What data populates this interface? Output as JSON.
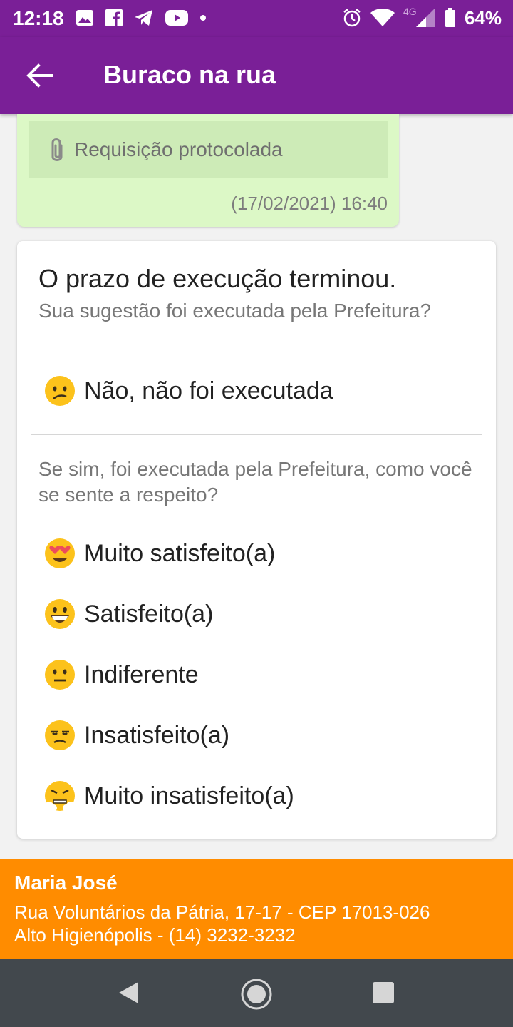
{
  "status_bar": {
    "time": "12:18",
    "battery_text": "64%",
    "network_label": "4G",
    "left_icons": [
      "image-icon",
      "facebook-icon",
      "telegram-icon",
      "youtube-icon",
      "dot-icon"
    ],
    "right_icons": [
      "alarm-icon",
      "wifi-icon",
      "signal-icon",
      "battery-icon"
    ]
  },
  "app_bar": {
    "title": "Buraco na rua",
    "back_icon": "arrow-back-icon",
    "color": "#7a1f97"
  },
  "message": {
    "attachment_label": "Requisição protocolada",
    "attachment_icon": "paperclip-icon",
    "timestamp": "(17/02/2021) 16:40",
    "bubble_color": "#dcf8c6"
  },
  "survey": {
    "title": "O prazo de execução terminou.",
    "question": "Sua sugestão foi executada pela Prefeitura?",
    "not_executed_option": {
      "emoji": "confused-face-icon",
      "label": "Não, não foi executada"
    },
    "satisfaction_question": "Se sim, foi executada pela Prefeitura, como você se sente a respeito?",
    "options": [
      {
        "emoji": "heart-eyes-face-icon",
        "label": "Muito satisfeito(a)"
      },
      {
        "emoji": "grinning-face-icon",
        "label": "Satisfeito(a)"
      },
      {
        "emoji": "neutral-face-icon",
        "label": "Indiferente"
      },
      {
        "emoji": "unamused-face-icon",
        "label": "Insatisfeito(a)"
      },
      {
        "emoji": "steam-face-icon",
        "label": "Muito insatisfeito(a)"
      }
    ]
  },
  "footer": {
    "name": "Maria José",
    "address_line1": "Rua Voluntários da Pátria, 17-17 - CEP 17013-026",
    "address_line2": "Alto Higienópolis - (14) 3232-3232",
    "color": "#ff8c00"
  },
  "nav_bar": {
    "icons": [
      "nav-back-icon",
      "nav-home-icon",
      "nav-recents-icon"
    ]
  }
}
